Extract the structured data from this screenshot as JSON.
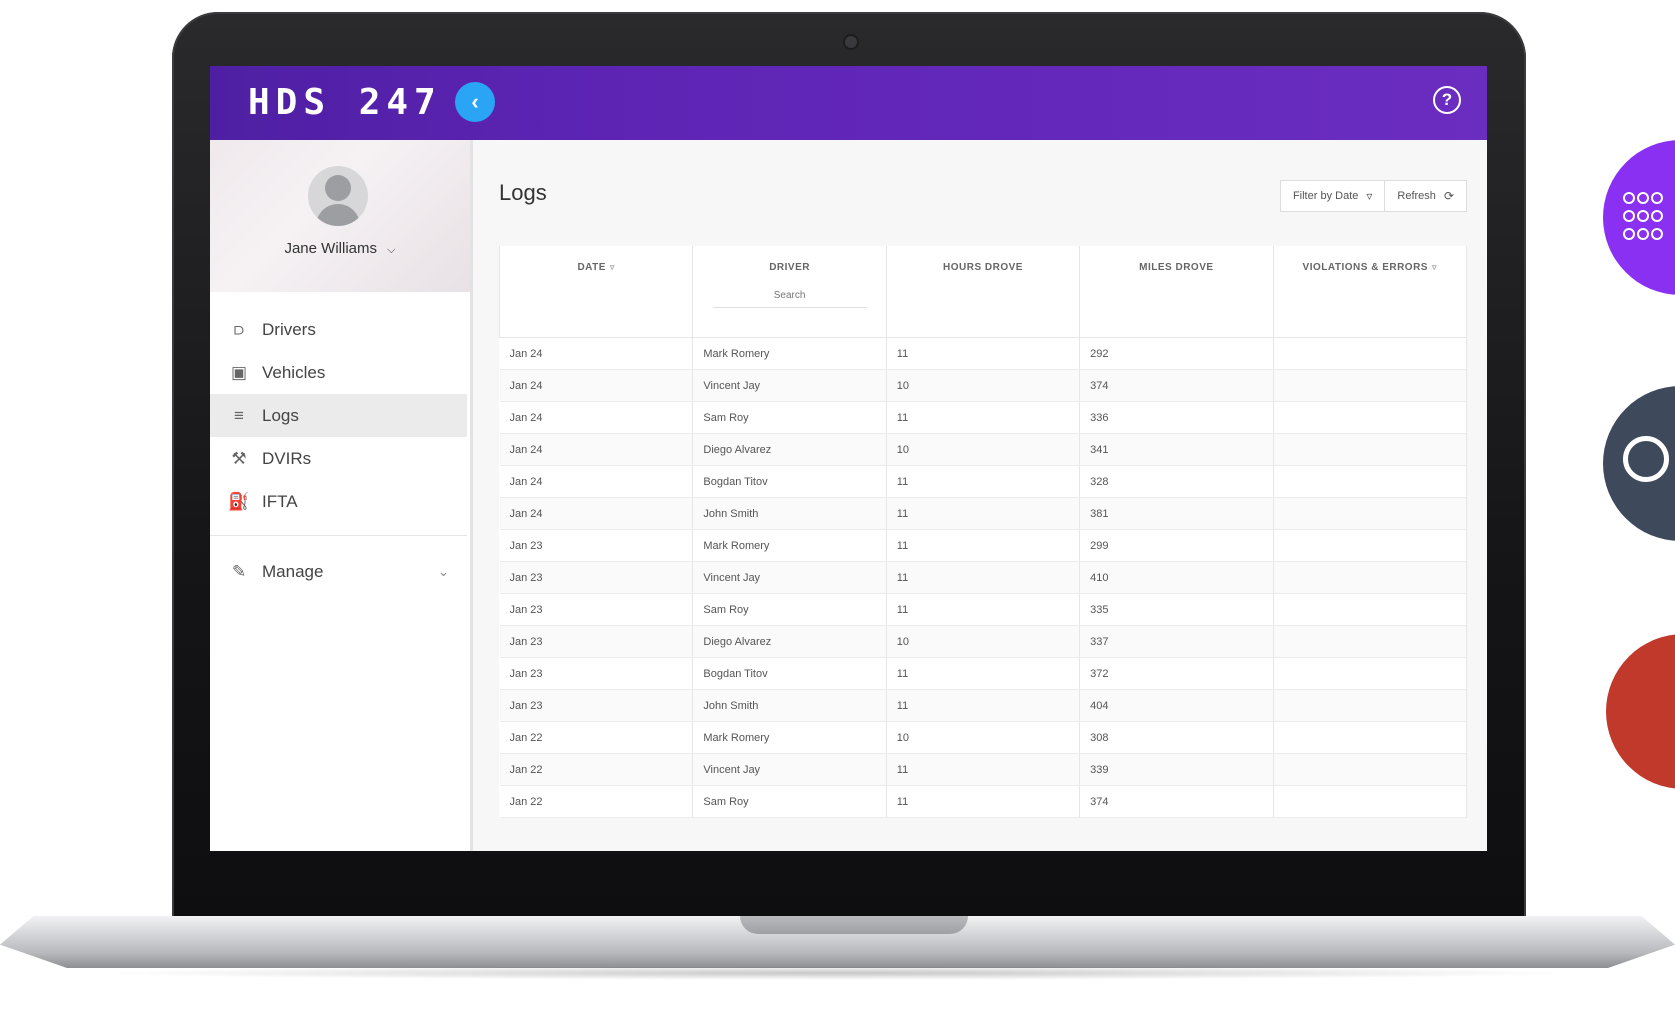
{
  "app": {
    "brand": "HDS 247",
    "collapse_icon": "chevron-left-icon",
    "help_icon": "help-circle-icon"
  },
  "colors": {
    "header_start": "#4e1fa3",
    "header_end": "#6a2dc0",
    "collapse_button": "#2aa4f4",
    "fab_purple": "#8a30f2",
    "fab_slate": "#3e4a5c",
    "fab_red": "#c0392b"
  },
  "profile": {
    "name": "Jane Williams",
    "menu_icon": "chevron-down-icon"
  },
  "sidebar": {
    "items": [
      {
        "label": "Drivers",
        "icon": "person-icon",
        "glyph": "⫐"
      },
      {
        "label": "Vehicles",
        "icon": "bus-icon",
        "glyph": "▣"
      },
      {
        "label": "Logs",
        "icon": "list-icon",
        "glyph": "≡",
        "active": true
      },
      {
        "label": "DVIRs",
        "icon": "wrench-icon",
        "glyph": "⚒"
      },
      {
        "label": "IFTA",
        "icon": "fuel-pump-icon",
        "glyph": "⛽"
      }
    ],
    "manage": {
      "label": "Manage",
      "icon": "ruler-pencil-icon",
      "glyph": "✎",
      "chevron": "⌄"
    }
  },
  "main": {
    "title": "Logs",
    "toolbar": {
      "filter_label": "Filter by Date",
      "refresh_label": "Refresh"
    },
    "table": {
      "columns": [
        "Date",
        "Driver",
        "Hours Drove",
        "Miles Drove",
        "Violations & Errors"
      ],
      "driver_search_placeholder": "Search",
      "rows": [
        [
          "Jan 24",
          "Mark Romery",
          "11",
          "292",
          ""
        ],
        [
          "Jan 24",
          "Vincent Jay",
          "10",
          "374",
          ""
        ],
        [
          "Jan 24",
          "Sam Roy",
          "11",
          "336",
          ""
        ],
        [
          "Jan 24",
          "Diego Alvarez",
          "10",
          "341",
          ""
        ],
        [
          "Jan 24",
          "Bogdan Titov",
          "11",
          "328",
          ""
        ],
        [
          "Jan 24",
          "John Smith",
          "11",
          "381",
          ""
        ],
        [
          "Jan 23",
          "Mark Romery",
          "11",
          "299",
          ""
        ],
        [
          "Jan 23",
          "Vincent Jay",
          "11",
          "410",
          ""
        ],
        [
          "Jan 23",
          "Sam Roy",
          "11",
          "335",
          ""
        ],
        [
          "Jan 23",
          "Diego Alvarez",
          "10",
          "337",
          ""
        ],
        [
          "Jan 23",
          "Bogdan Titov",
          "11",
          "372",
          ""
        ],
        [
          "Jan 23",
          "John Smith",
          "11",
          "404",
          ""
        ],
        [
          "Jan 22",
          "Mark Romery",
          "10",
          "308",
          ""
        ],
        [
          "Jan 22",
          "Vincent Jay",
          "11",
          "339",
          ""
        ],
        [
          "Jan 22",
          "Sam Roy",
          "11",
          "374",
          ""
        ]
      ]
    }
  }
}
